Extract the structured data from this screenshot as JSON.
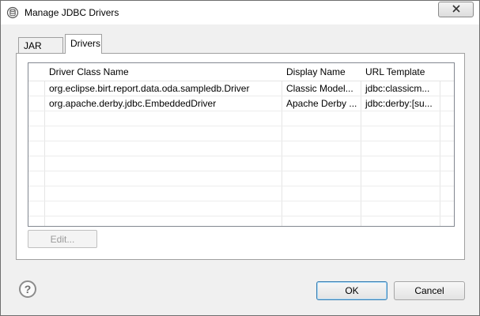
{
  "window": {
    "title": "Manage JDBC Drivers"
  },
  "tabs": [
    {
      "label": "JAR Files",
      "selected": false
    },
    {
      "label": "Drivers",
      "selected": true
    }
  ],
  "table": {
    "columns": [
      "Driver Class Name",
      "Display Name",
      "URL Template"
    ],
    "rows": [
      [
        "org.eclipse.birt.report.data.oda.sampledb.Driver",
        "Classic Model...",
        "jdbc:classicm..."
      ],
      [
        "org.apache.derby.jdbc.EmbeddedDriver",
        "Apache Derby ...",
        "jdbc:derby:[su..."
      ]
    ]
  },
  "buttons": {
    "edit_label": "Edit...",
    "ok_label": "OK",
    "cancel_label": "Cancel"
  },
  "colors": {
    "default_button_border": "#3c7fb1",
    "disabled_text": "#9a9a9a"
  },
  "icons": {
    "app": "database-icon",
    "close": "close-icon",
    "help": "help-icon"
  }
}
